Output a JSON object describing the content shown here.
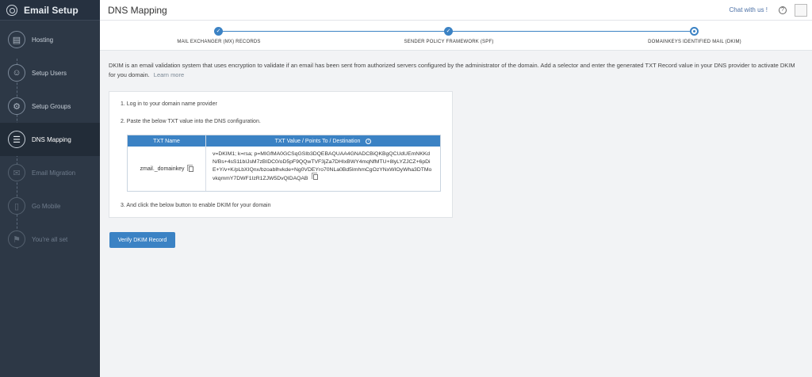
{
  "sidebar": {
    "title": "Email Setup",
    "items": [
      {
        "label": "Hosting",
        "icon": "server-icon"
      },
      {
        "label": "Setup Users",
        "icon": "users-icon"
      },
      {
        "label": "Setup Groups",
        "icon": "groups-icon"
      },
      {
        "label": "DNS Mapping",
        "icon": "dns-icon"
      },
      {
        "label": "Email Migration",
        "icon": "migration-icon"
      },
      {
        "label": "Go Mobile",
        "icon": "mobile-icon"
      },
      {
        "label": "You're all set",
        "icon": "flag-icon"
      }
    ]
  },
  "header": {
    "title": "DNS Mapping",
    "chat": "Chat with us !",
    "help": "?"
  },
  "progress": {
    "steps": [
      {
        "label": "MAIL EXCHANGER (MX) RECORDS",
        "status": "done"
      },
      {
        "label": "SENDER POLICY FRAMEWORK (SPF)",
        "status": "done"
      },
      {
        "label": "DOMAINKEYS IDENTIFIED MAIL (DKIM)",
        "status": "current"
      }
    ],
    "check": "✓"
  },
  "main": {
    "description": "DKIM is an email validation system that uses encryption to validate if an email has been sent from authorized servers configured by the administrator of the domain. Add a selector and enter the generated TXT Record value in your DNS provider to activate DKIM for you domain.",
    "learn_more": "Learn more",
    "step1": "1. Log in to your domain name provider",
    "step2": "2. Paste the below TXT value into the DNS configuration.",
    "step3": "3. And click the below button to enable DKIM for your domain",
    "table": {
      "col_name": "TXT Name",
      "col_value": "TXT Value / Points To / Destination",
      "info": "i",
      "name": "zmail._domainkey",
      "value": "v=DKIM1; k=rsa; p=MIGfMA0GCSqGSIb3DQEBAQUAA4GNADCBiQKBgQCUdUEmNKKdN/Bs+4sS11bIJsM7zBIDC0/oD5pF9QQwTVF3jZa7DHIxBWY4mqNfMTU+8lyLYZJCZ+6pDiE+Y/v+K/pLbXIQnx/bzoablhvkde+Ng0VDEYro70NLa0Bd5ImhmCgOzYNxWIOyWha3DTMovkqmmY7DWF1IzR1ZJW5DvQIDAQAB"
    },
    "verify_label": "Verify DKIM Record"
  },
  "colors": {
    "sidebar_bg": "#2d3846",
    "accent": "#3b82c4"
  }
}
